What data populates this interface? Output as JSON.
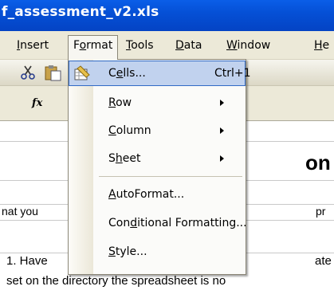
{
  "window": {
    "title": "f_assessment_v2.xls"
  },
  "menubar": {
    "items": [
      {
        "label": "Insert",
        "u": "I"
      },
      {
        "label": "Format",
        "u": "o"
      },
      {
        "label": "Tools",
        "u": "T"
      },
      {
        "label": "Data",
        "u": "D"
      },
      {
        "label": "Window",
        "u": "W"
      },
      {
        "label": "He",
        "u": "H"
      }
    ]
  },
  "formula_bar": {
    "fx": "fx"
  },
  "sheet": {
    "row_text": [
      "nat you",
      "1. Have",
      "set on the directory the spreadsheet is no"
    ],
    "right_text": [
      "pr",
      "ate"
    ],
    "big_text": "on"
  },
  "format_menu": {
    "items": [
      {
        "label": "Cells...",
        "u": "e",
        "shortcut": "Ctrl+1",
        "icon": "cells-icon",
        "highlighted": true
      },
      {
        "label": "Row",
        "u": "R",
        "submenu": true
      },
      {
        "label": "Column",
        "u": "C",
        "submenu": true
      },
      {
        "label": "Sheet",
        "u": "h",
        "submenu": true
      },
      {
        "label": "AutoFormat...",
        "u": "A"
      },
      {
        "label": "Conditional Formatting...",
        "u": "d"
      },
      {
        "label": "Style...",
        "u": "S"
      }
    ]
  },
  "colors": {
    "title_bar": "#0550d6",
    "menu_highlight": "#c1d2ee",
    "menu_highlight_border": "#316ac5"
  }
}
